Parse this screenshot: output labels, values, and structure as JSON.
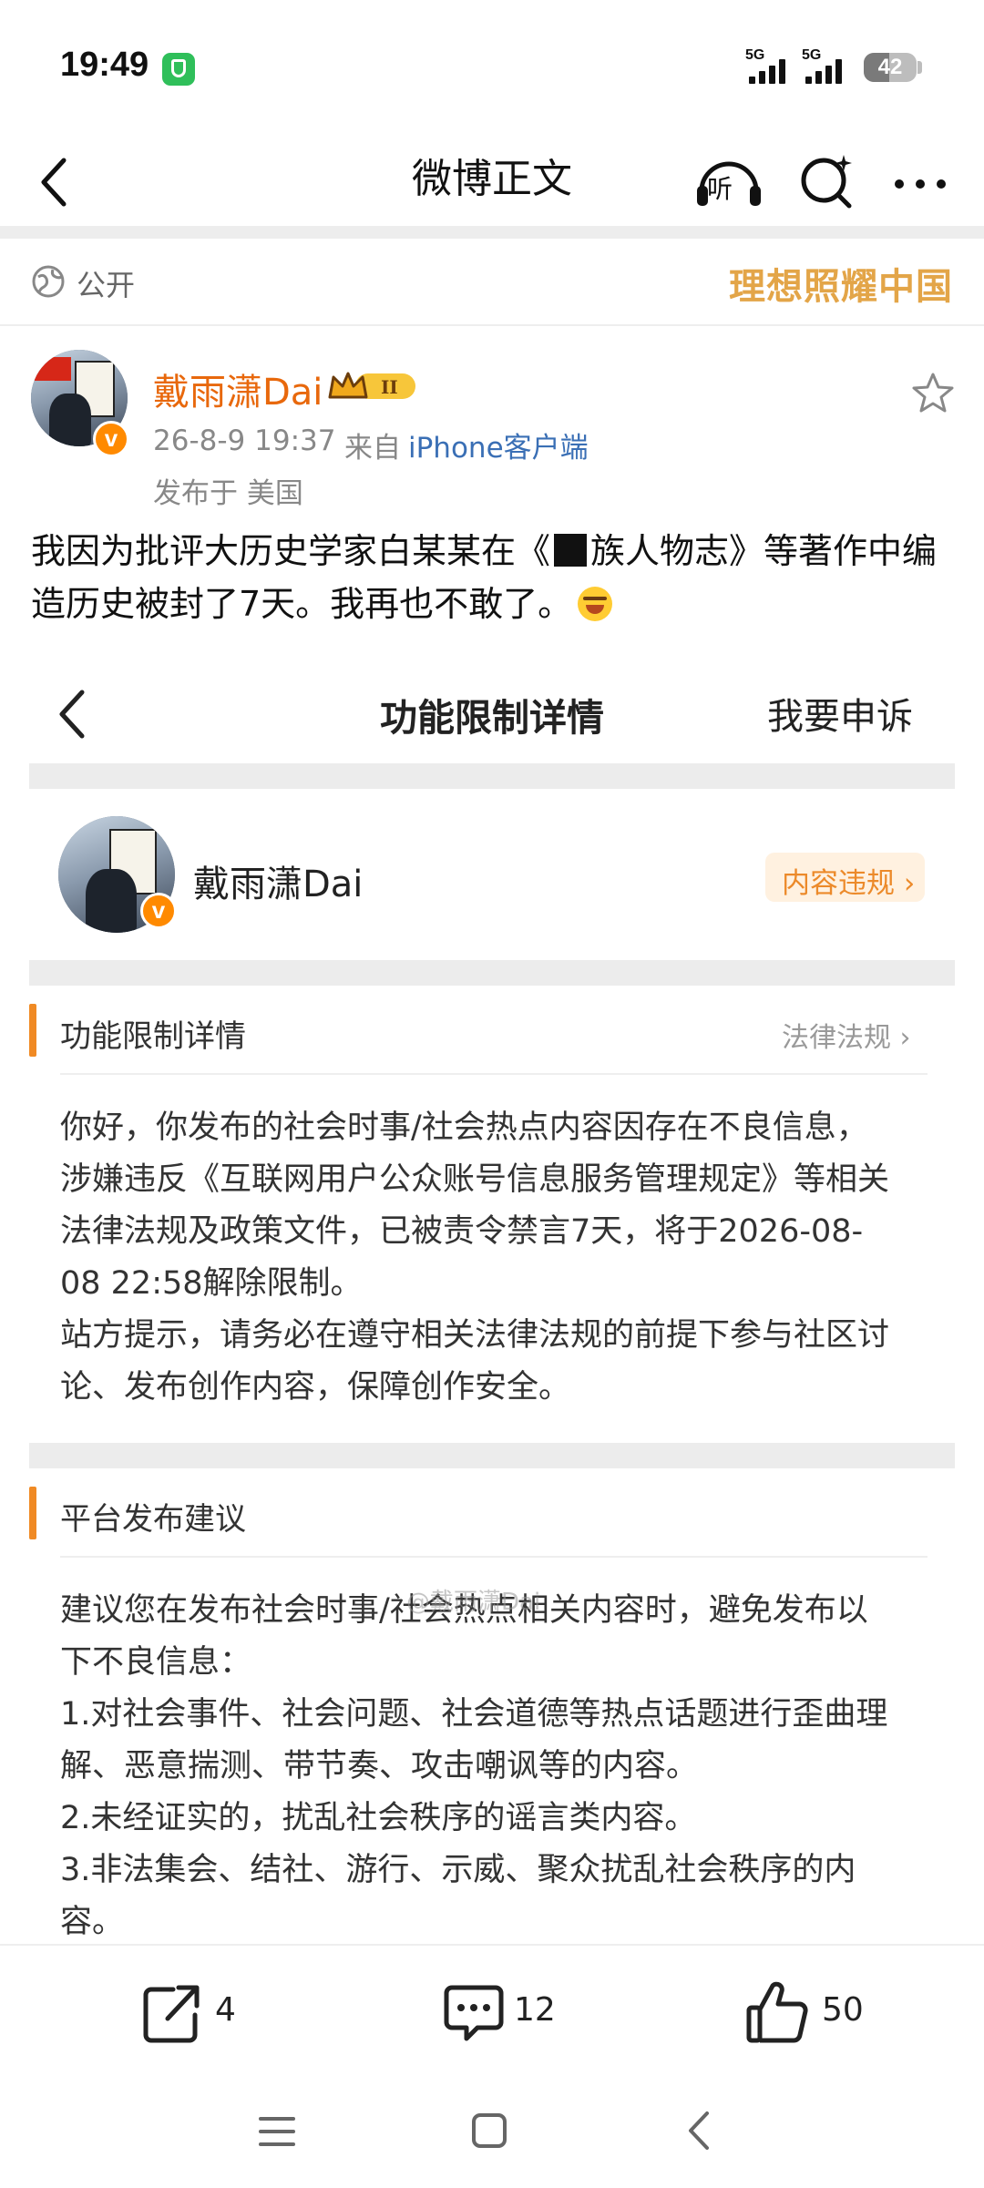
{
  "status_bar": {
    "time": "19:49",
    "signal1_label": "5G",
    "signal2_label": "5G",
    "battery": "42",
    "icons": [
      "shield-icon",
      "signal-icon",
      "battery-icon"
    ]
  },
  "nav": {
    "title": "微博正文",
    "listen_label": "听",
    "icons": [
      "back-arrow-icon",
      "headphones-icon",
      "sparkle-search-icon",
      "more-icon"
    ]
  },
  "visibility": {
    "label": "公开",
    "slogan": "理想照耀中国"
  },
  "post": {
    "author": "戴雨潇Dai",
    "time": "26-8-9 19:37",
    "from_prefix": "来自",
    "source": "iPhone客户端",
    "location": "发布于 美国",
    "text_part1": "我因为批评大历史学家白某某在《",
    "text_part2": "族人物志》等著作中编造历史被封了7天。我再也不敢了。"
  },
  "embedded": {
    "title": "功能限制详情",
    "appeal": "我要申诉",
    "user_name": "戴雨潇Dai",
    "violation_label": "内容违规 ›",
    "section1": {
      "title": "功能限制详情",
      "link": "法律法规 ›",
      "lines": [
        "你好，你发布的社会时事/社会热点内容因存在不良信息，",
        "涉嫌违反《互联网用户公众账号信息服务管理规定》等相关",
        "法律法规及政策文件，已被责令禁言7天，将于2026-08-",
        "08 22:58解除限制。",
        "站方提示，请务必在遵守相关法律法规的前提下参与社区讨",
        "论、发布创作内容，保障创作安全。"
      ]
    },
    "section2": {
      "title": "平台发布建议",
      "lines": [
        "建议您在发布社会时事/社会热点相关内容时，避免发布以",
        "下不良信息：",
        "1.对社会事件、社会问题、社会道德等热点话题进行歪曲理",
        "解、恶意揣测、带节奏、攻击嘲讽等的内容。",
        "2.未经证实的，扰乱社会秩序的谣言类内容。",
        "3.非法集会、结社、游行、示威、聚众扰乱社会秩序的内",
        "容。"
      ]
    },
    "watermark": "@戴雨潇Dai"
  },
  "actions": {
    "repost_count": "4",
    "comment_count": "12",
    "like_count": "50"
  },
  "colors": {
    "author": "#e8680c",
    "accent": "#f08a24",
    "link_blue": "#3a6fb5",
    "slogan_gold": "#e3a548"
  }
}
